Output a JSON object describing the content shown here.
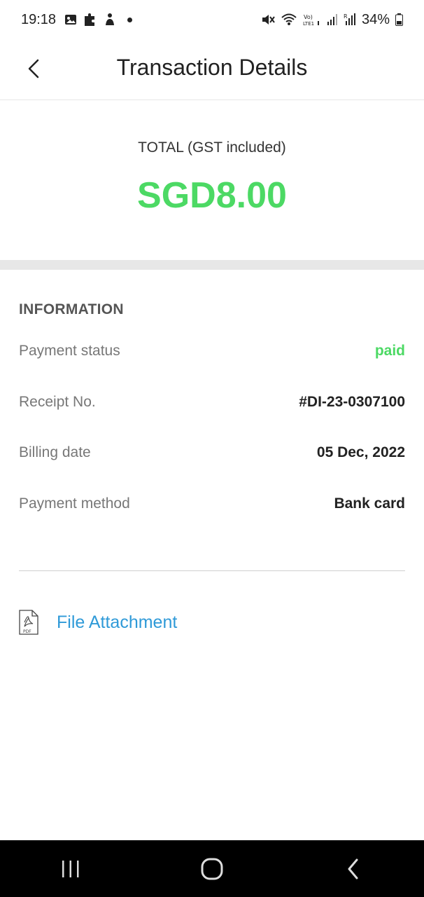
{
  "status_bar": {
    "time": "19:18",
    "battery": "34%",
    "icons_left": [
      "gallery-icon",
      "puzzle-icon",
      "accessibility-icon",
      "notification-dot-icon"
    ],
    "icons_right": [
      "mute-icon",
      "wifi-icon",
      "volte-icon",
      "signal-icon",
      "signal-roaming-icon",
      "battery-icon"
    ]
  },
  "header": {
    "title": "Transaction Details",
    "back_icon": "chevron-left-icon"
  },
  "total": {
    "label": "TOTAL (GST included)",
    "amount": "SGD8.00",
    "color": "#4cd964"
  },
  "information": {
    "title": "INFORMATION",
    "rows": [
      {
        "label": "Payment status",
        "value": "paid",
        "value_color": "#4cd964"
      },
      {
        "label": "Receipt No.",
        "value": "#DI-23-0307100"
      },
      {
        "label": "Billing date",
        "value": "05 Dec, 2022"
      },
      {
        "label": "Payment method",
        "value": "Bank card"
      }
    ]
  },
  "attachment": {
    "label": "File Attachment",
    "icon": "pdf-file-icon",
    "icon_text": "PDF",
    "color": "#2f9ad8"
  },
  "nav_bar": {
    "buttons": [
      "recent-apps-icon",
      "home-icon",
      "back-icon"
    ]
  }
}
